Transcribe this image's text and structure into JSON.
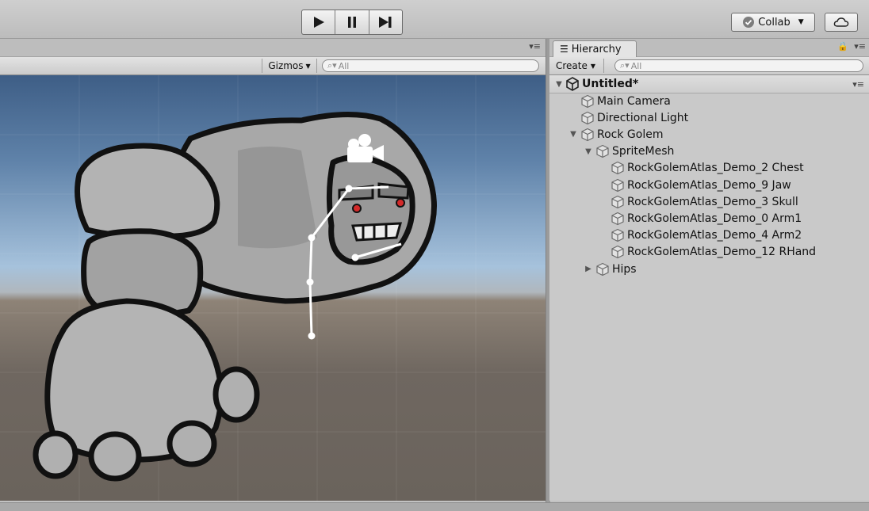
{
  "toolbar": {
    "collab_label": "Collab",
    "play_icons": [
      "play-icon",
      "pause-icon",
      "step-icon"
    ]
  },
  "scene": {
    "gizmos_label": "Gizmos",
    "search_placeholder": "All"
  },
  "hierarchy": {
    "tab_label": "Hierarchy",
    "create_label": "Create",
    "search_placeholder": "All",
    "scene_name": "Untitled*",
    "items": [
      {
        "label": "Main Camera",
        "depth": 0,
        "expander": "none"
      },
      {
        "label": "Directional Light",
        "depth": 0,
        "expander": "none"
      },
      {
        "label": "Rock Golem",
        "depth": 0,
        "expander": "expanded"
      },
      {
        "label": "SpriteMesh",
        "depth": 1,
        "expander": "expanded"
      },
      {
        "label": "RockGolemAtlas_Demo_2 Chest",
        "depth": 2,
        "expander": "none"
      },
      {
        "label": "RockGolemAtlas_Demo_9 Jaw",
        "depth": 2,
        "expander": "none"
      },
      {
        "label": "RockGolemAtlas_Demo_3 Skull",
        "depth": 2,
        "expander": "none"
      },
      {
        "label": "RockGolemAtlas_Demo_0 Arm1",
        "depth": 2,
        "expander": "none"
      },
      {
        "label": "RockGolemAtlas_Demo_4 Arm2",
        "depth": 2,
        "expander": "none"
      },
      {
        "label": "RockGolemAtlas_Demo_12 RHand",
        "depth": 2,
        "expander": "none"
      },
      {
        "label": "Hips",
        "depth": 1,
        "expander": "collapsed"
      }
    ]
  },
  "colors": {
    "sky_top": "#3e5e86",
    "horizon": "#a6c2dc",
    "ground": "#6a635c",
    "golem_fill": "#a9a9a9",
    "golem_outline": "#111111",
    "golem_eye": "#d42a2a"
  }
}
